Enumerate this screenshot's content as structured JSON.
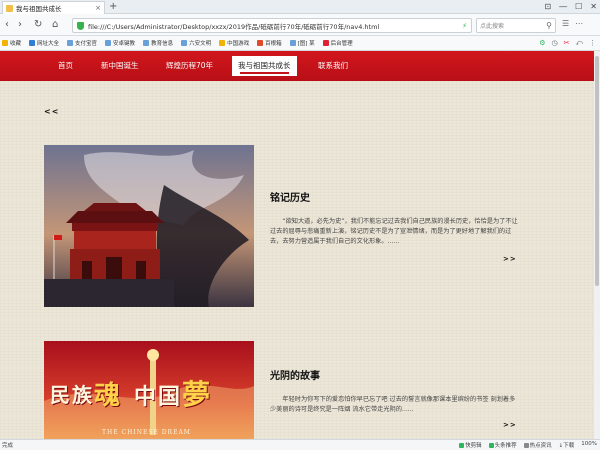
{
  "browser": {
    "tab_title": "我与祖国共成长",
    "tab_close": "×",
    "new_tab": "+",
    "window_controls": [
      "⊡",
      "―",
      "☐",
      "✕"
    ],
    "nav": {
      "back": "‹",
      "forward": "›",
      "reload": "↻",
      "home": "⌂"
    },
    "url": "file:///C:/Users/Administrator/Desktop/xxzx/2019作品/砥砺前行70年/砥砺前行70年/nav4.html",
    "url_icon": "⚡",
    "search_placeholder": "点此搜索",
    "bookmarks": [
      "收藏",
      "网址大全",
      "支付宝官",
      "安卓键教",
      "教育信息",
      "六安文明",
      "中国游戏",
      "百根箱",
      "[图] 某",
      "后台管理"
    ],
    "bookmark_tools": [
      "⚙",
      "◷",
      "✂",
      "⤺",
      "⋮"
    ],
    "status_left": "完成",
    "status_right": [
      "快剪辑",
      "头条推荐",
      "热点资讯",
      "下载",
      "100%"
    ]
  },
  "site": {
    "nav": [
      {
        "label": "首页",
        "active": false
      },
      {
        "label": "新中国诞生",
        "active": false
      },
      {
        "label": "辉煌历程70年",
        "active": false
      },
      {
        "label": "我与祖国共成长",
        "active": true
      },
      {
        "label": "联系我们",
        "active": false
      }
    ],
    "back_label": "<<",
    "articles": [
      {
        "title": "铭记历史",
        "text": "“欲知大道，必先为史”，我们不能忘记过去我们自己民族的漫长历史，恰恰是为了不让过去的屈辱与悲痛重新上演，铭记历史不是为了宣泄情绪，而是为了更好地了解我们的过去，去努力营造属于我们自己的文化形象。......",
        "more": ">>"
      },
      {
        "title": "光阴的故事",
        "text": "年轻时为你写下的爱恋怕你早已忘了吧 过去的誓言就像那课本里缤纷的书签 刻划着多少美丽的诗可是终究是一阵烟 流水它带走光阴的......",
        "more": ">>"
      }
    ],
    "poster_text": {
      "chars": [
        "民",
        "族",
        "魂",
        "中",
        "国",
        "夢"
      ],
      "sub": "THE CHINESE DREAM"
    }
  },
  "colors": {
    "nav_red": "#c4141b",
    "page_bg": "#ece6d7"
  }
}
